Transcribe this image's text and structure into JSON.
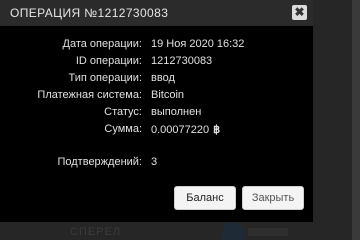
{
  "dialog": {
    "title": "ОПЕРАЦИЯ №1212730083",
    "close_glyph": "✖"
  },
  "details": [
    {
      "label": "Дата операции:",
      "value": "19 Ноя 2020 16:32"
    },
    {
      "label": "ID операции:",
      "value": "1212730083"
    },
    {
      "label": "Тип операции:",
      "value": "ввод"
    },
    {
      "label": "Платежная система:",
      "value": "Bitcoin"
    },
    {
      "label": "Статус:",
      "value": "выполнен"
    },
    {
      "label": "Сумма:",
      "value": "0.00077220",
      "currency_symbol": "฿"
    }
  ],
  "confirmations": {
    "label": "Подтверждений:",
    "value": "3"
  },
  "buttons": {
    "balance_label": "Баланс",
    "close_label": "Закрыть"
  },
  "background": {
    "bottom_text": "СПЕРЕЛ"
  }
}
